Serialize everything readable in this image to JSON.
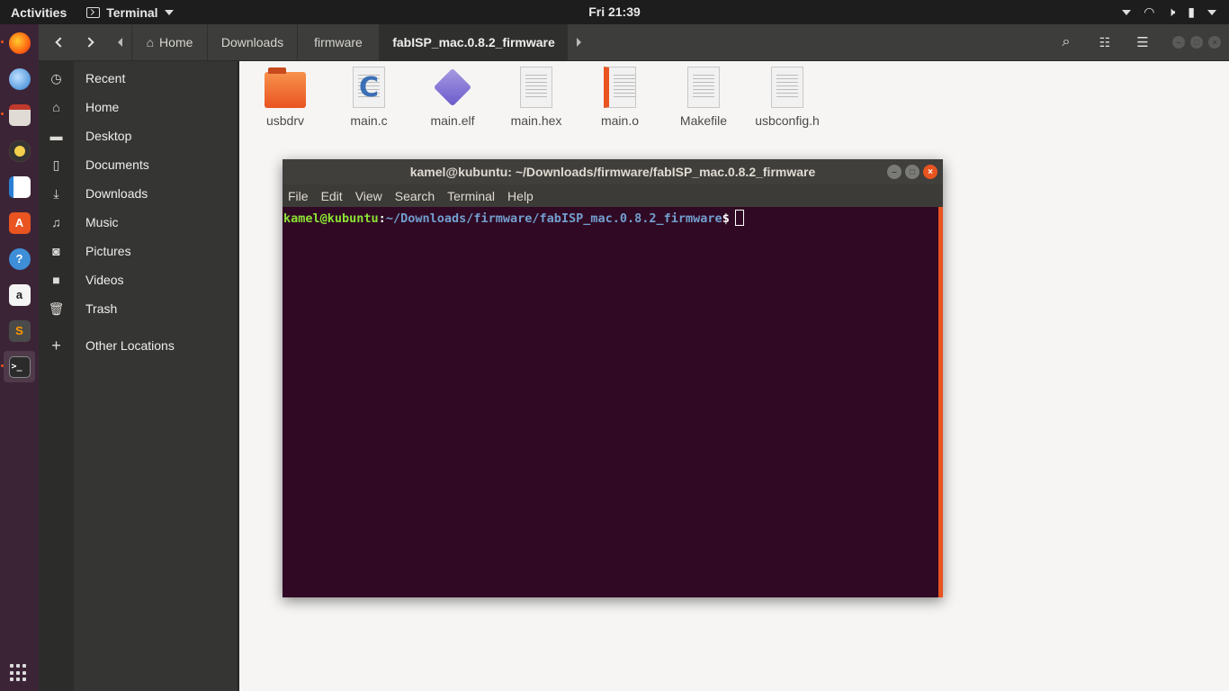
{
  "topbar": {
    "activities_label": "Activities",
    "app_name": "Terminal",
    "clock": "Fri 21:39"
  },
  "dock": {
    "apps": [
      "firefox",
      "thunderbird",
      "files",
      "rhythmbox",
      "libreoffice-writer",
      "ubuntu-software",
      "help",
      "amazon",
      "sublime-text",
      "terminal"
    ]
  },
  "nautilus": {
    "breadcrumbs": [
      "Home",
      "Downloads",
      "firmware",
      "fabISP_mac.0.8.2_firmware"
    ],
    "sidebar": [
      {
        "icon": "recent-icon",
        "label": "Recent"
      },
      {
        "icon": "home-icon",
        "label": "Home"
      },
      {
        "icon": "desktop-icon",
        "label": "Desktop"
      },
      {
        "icon": "documents-icon",
        "label": "Documents"
      },
      {
        "icon": "downloads-icon",
        "label": "Downloads"
      },
      {
        "icon": "music-icon",
        "label": "Music"
      },
      {
        "icon": "pictures-icon",
        "label": "Pictures"
      },
      {
        "icon": "videos-icon",
        "label": "Videos"
      },
      {
        "icon": "trash-icon",
        "label": "Trash"
      },
      {
        "icon": "plus-icon",
        "label": "Other Locations"
      }
    ],
    "files": [
      {
        "name": "usbdrv",
        "type": "folder"
      },
      {
        "name": "main.c",
        "type": "c-source"
      },
      {
        "name": "main.elf",
        "type": "binary"
      },
      {
        "name": "main.hex",
        "type": "text"
      },
      {
        "name": "main.o",
        "type": "object"
      },
      {
        "name": "Makefile",
        "type": "text"
      },
      {
        "name": "usbconfig.h",
        "type": "header"
      }
    ]
  },
  "terminal": {
    "title": "kamel@kubuntu: ~/Downloads/firmware/fabISP_mac.0.8.2_firmware",
    "menu": [
      "File",
      "Edit",
      "View",
      "Search",
      "Terminal",
      "Help"
    ],
    "prompt_user": "kamel@kubuntu",
    "prompt_sep": ":",
    "prompt_path": "~/Downloads/firmware/fabISP_mac.0.8.2_firmware",
    "prompt_dollar": "$"
  },
  "colors": {
    "terminal_bg": "#300a24",
    "prompt_user": "#8ae234",
    "prompt_path": "#729fcf",
    "accent": "#e95420",
    "dock_bg": "#3c2437"
  }
}
